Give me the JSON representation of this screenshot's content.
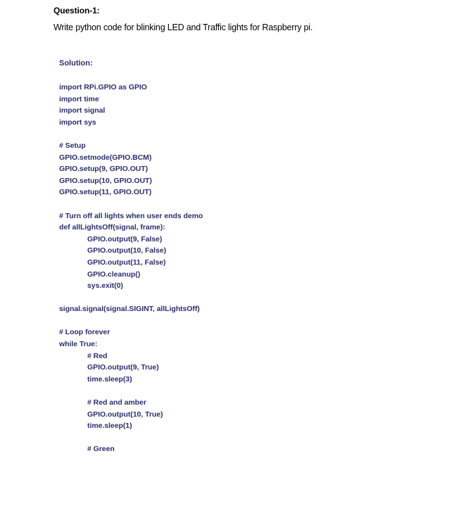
{
  "question": {
    "heading": "Question-1:",
    "text": "Write python code for blinking LED and Traffic lights for Raspberry pi."
  },
  "solution": {
    "label": "Solution:",
    "lines": {
      "l1": "import RPi.GPIO as GPIO",
      "l2": "import time",
      "l3": "import signal",
      "l4": "import sys",
      "l5": "# Setup",
      "l6": "GPIO.setmode(GPIO.BCM)",
      "l7": "GPIO.setup(9, GPIO.OUT)",
      "l8": "GPIO.setup(10, GPIO.OUT)",
      "l9": "GPIO.setup(11, GPIO.OUT)",
      "l10": "# Turn off all lights when user ends demo",
      "l11": "def allLightsOff(signal, frame):",
      "l12": "GPIO.output(9, False)",
      "l13": "GPIO.output(10, False)",
      "l14": "GPIO.output(11, False)",
      "l15": "GPIO.cleanup()",
      "l16": "sys.exit(0)",
      "l17": "signal.signal(signal.SIGINT, allLightsOff)",
      "l18": "# Loop forever",
      "l19": "while True:",
      "l20": "# Red",
      "l21": "GPIO.output(9, True)",
      "l22": "time.sleep(3)",
      "l23": "# Red and amber",
      "l24": "GPIO.output(10, True)",
      "l25": "time.sleep(1)",
      "l26": "# Green"
    }
  }
}
